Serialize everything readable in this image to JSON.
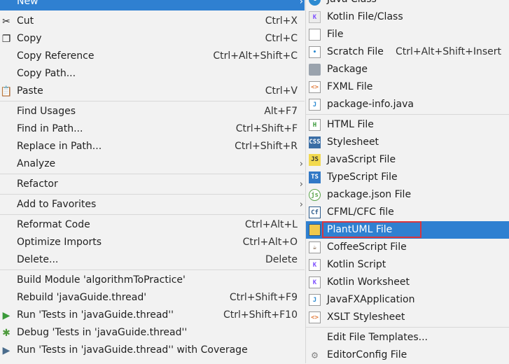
{
  "left_menu": {
    "items": [
      {
        "label": "New",
        "shortcut": "",
        "has_submenu": true
      },
      {
        "label": "Cut",
        "shortcut": "Ctrl+X",
        "icon": "scissors-icon"
      },
      {
        "label": "Copy",
        "shortcut": "Ctrl+C",
        "icon": "copy-icon"
      },
      {
        "label": "Copy Reference",
        "shortcut": "Ctrl+Alt+Shift+C"
      },
      {
        "label": "Copy Path...",
        "shortcut": ""
      },
      {
        "label": "Paste",
        "shortcut": "Ctrl+V",
        "icon": "clipboard-icon"
      },
      {
        "label": "Find Usages",
        "shortcut": "Alt+F7"
      },
      {
        "label": "Find in Path...",
        "shortcut": "Ctrl+Shift+F"
      },
      {
        "label": "Replace in Path...",
        "shortcut": "Ctrl+Shift+R"
      },
      {
        "label": "Analyze",
        "shortcut": "",
        "has_submenu": true
      },
      {
        "label": "Refactor",
        "shortcut": "",
        "has_submenu": true
      },
      {
        "label": "Add to Favorites",
        "shortcut": "",
        "has_submenu": true
      },
      {
        "label": "Reformat Code",
        "shortcut": "Ctrl+Alt+L"
      },
      {
        "label": "Optimize Imports",
        "shortcut": "Ctrl+Alt+O"
      },
      {
        "label": "Delete...",
        "shortcut": "Delete"
      },
      {
        "label": "Build Module 'algorithmToPractice'",
        "shortcut": ""
      },
      {
        "label": "Rebuild 'javaGuide.thread'",
        "shortcut": "Ctrl+Shift+F9"
      },
      {
        "label": "Run 'Tests in 'javaGuide.thread''",
        "shortcut": "Ctrl+Shift+F10",
        "icon": "run-icon"
      },
      {
        "label": "Debug 'Tests in 'javaGuide.thread''",
        "shortcut": "",
        "icon": "debug-icon"
      },
      {
        "label": "Run 'Tests in 'javaGuide.thread'' with Coverage",
        "shortcut": "",
        "icon": "coverage-icon"
      }
    ]
  },
  "right_menu": {
    "items": [
      {
        "label": "Java Class",
        "shortcut": "",
        "icon": "java-class-icon"
      },
      {
        "label": "Kotlin File/Class",
        "shortcut": "",
        "icon": "kotlin-file-icon"
      },
      {
        "label": "File",
        "shortcut": "",
        "icon": "file-icon"
      },
      {
        "label": "Scratch File",
        "shortcut": "Ctrl+Alt+Shift+Insert",
        "icon": "scratch-file-icon"
      },
      {
        "label": "Package",
        "shortcut": "",
        "icon": "package-icon"
      },
      {
        "label": "FXML File",
        "shortcut": "",
        "icon": "fxml-file-icon"
      },
      {
        "label": "package-info.java",
        "shortcut": "",
        "icon": "java-file-icon"
      },
      {
        "label": "HTML File",
        "shortcut": "",
        "icon": "html-file-icon"
      },
      {
        "label": "Stylesheet",
        "shortcut": "",
        "icon": "css-file-icon"
      },
      {
        "label": "JavaScript File",
        "shortcut": "",
        "icon": "js-file-icon"
      },
      {
        "label": "TypeScript File",
        "shortcut": "",
        "icon": "ts-file-icon"
      },
      {
        "label": "package.json File",
        "shortcut": "",
        "icon": "nodejs-icon"
      },
      {
        "label": "CFML/CFC file",
        "shortcut": "",
        "icon": "cfml-icon"
      },
      {
        "label": "PlantUML File",
        "shortcut": "",
        "icon": "plantuml-icon",
        "selected": true
      },
      {
        "label": "CoffeeScript File",
        "shortcut": "",
        "icon": "coffeescript-icon"
      },
      {
        "label": "Kotlin Script",
        "shortcut": "",
        "icon": "kotlin-script-icon"
      },
      {
        "label": "Kotlin Worksheet",
        "shortcut": "",
        "icon": "kotlin-worksheet-icon"
      },
      {
        "label": "JavaFXApplication",
        "shortcut": "",
        "icon": "javafx-icon"
      },
      {
        "label": "XSLT Stylesheet",
        "shortcut": "",
        "icon": "xslt-icon"
      },
      {
        "label": "Edit File Templates...",
        "shortcut": ""
      },
      {
        "label": "EditorConfig File",
        "shortcut": "",
        "icon": "gear-icon"
      }
    ]
  },
  "colors": {
    "selection": "#2f80d1",
    "highlight_border": "#d9363e",
    "menu_bg": "#f2f2f2"
  }
}
